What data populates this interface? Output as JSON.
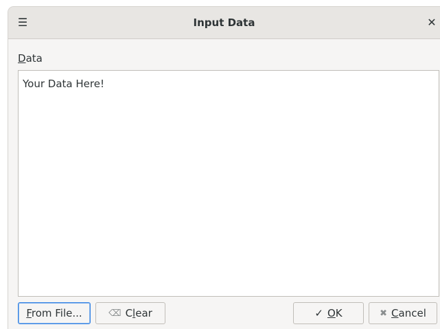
{
  "window": {
    "title": "Input Data",
    "menu_icon": "hamburger-menu-icon",
    "close_icon": "close-icon"
  },
  "form": {
    "data_label_mnemonic": "D",
    "data_label_rest": "ata",
    "data_value": "Your Data Here!"
  },
  "buttons": {
    "from_file_mnemonic": "F",
    "from_file_rest": "rom File...",
    "clear_prefix": "C",
    "clear_mnemonic": "l",
    "clear_rest": "ear",
    "clear_icon": "backspace-icon",
    "ok_mnemonic": "O",
    "ok_rest": "K",
    "ok_icon": "checkmark-icon",
    "cancel_mnemonic": "C",
    "cancel_rest": "ancel",
    "cancel_icon": "cancel-x-icon"
  },
  "colors": {
    "focus_accent": "#3584e4",
    "titlebar": "#e8e6e3",
    "window_bg": "#f6f5f4"
  }
}
